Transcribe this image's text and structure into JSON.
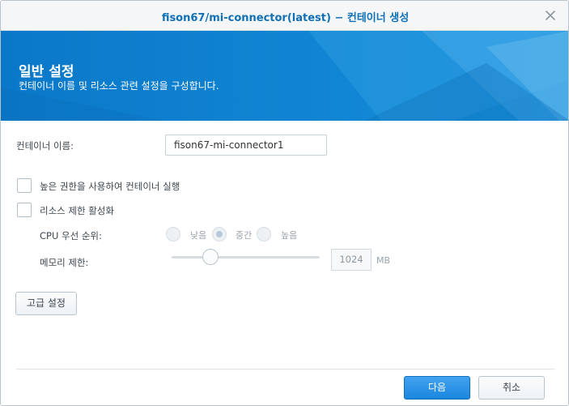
{
  "window": {
    "title": "fison67/mi-connector(latest) − 컨테이너 생성",
    "close_icon": "close-icon"
  },
  "banner": {
    "title": "일반 설정",
    "subtitle": "컨테이너 이름 및 리소스 관련 설정을 구성합니다.",
    "color": "#0b7fcf"
  },
  "form": {
    "container_name_label": "컨테이너 이름:",
    "container_name_value": "fison67-mi-connector1",
    "privileged_label": "높은 권한을 사용하여 컨테이너 실행",
    "privileged_checked": false,
    "resource_limit_label": "리소스 제한 활성화",
    "resource_limit_checked": false,
    "cpu_priority_label": "CPU 우선 순위:",
    "cpu_options": [
      "낮음",
      "중간",
      "높음"
    ],
    "cpu_selected": "중간",
    "memory_label": "메모리 제한:",
    "memory_value": "1024",
    "memory_unit": "MB",
    "memory_slider_fraction": 0.27,
    "advanced_button": "고급 설정"
  },
  "footer": {
    "next_button": "다음",
    "cancel_button": "취소",
    "accent_color": "#1a86de"
  }
}
